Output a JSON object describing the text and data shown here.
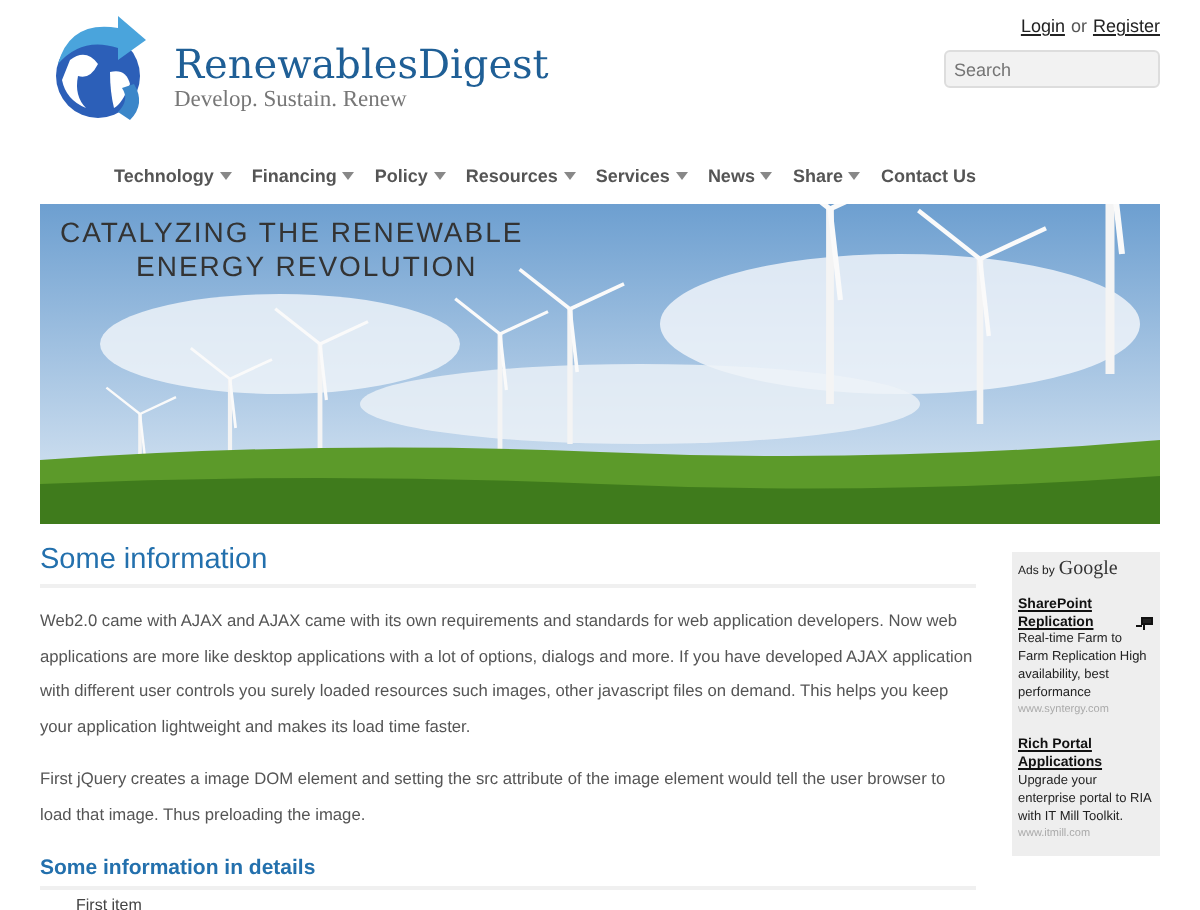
{
  "header": {
    "site_title": "RenewablesDigest",
    "tagline": "Develop. Sustain. Renew",
    "login": "Login",
    "separator": "or",
    "register": "Register",
    "search": {
      "placeholder": "Search"
    }
  },
  "nav": [
    {
      "label": "Technology",
      "dropdown": true
    },
    {
      "label": "Financing",
      "dropdown": true
    },
    {
      "label": "Policy",
      "dropdown": true
    },
    {
      "label": "Resources",
      "dropdown": true
    },
    {
      "label": "Services",
      "dropdown": true
    },
    {
      "label": "News",
      "dropdown": true
    },
    {
      "label": "Share",
      "dropdown": true
    },
    {
      "label": "Contact Us",
      "dropdown": false
    }
  ],
  "banner": {
    "headline_line1": "CATALYZING THE RENEWABLE",
    "headline_line2": "ENERGY REVOLUTION"
  },
  "content": {
    "heading": "Some information",
    "paragraphs": [
      "Web2.0 came with AJAX and AJAX came with its own requirements and standards for web application developers. Now web applications are more like desktop applications with a lot of options, dialogs and more. If you have developed AJAX application with different user controls you surely loaded resources such images, other javascript files on demand. This helps you keep your application lightweight and makes its load time faster.",
      "First jQuery creates a image DOM element and setting the src attribute of the image element would tell the user browser to load that image. Thus preloading the image."
    ],
    "subheading": "Some information in details",
    "list": [
      "First item"
    ]
  },
  "ads": {
    "label": "Ads by",
    "brand": "Google",
    "items": [
      {
        "title": "SharePoint Replication",
        "text": "Real-time Farm to Farm Replication High availability, best performance",
        "url": "www.syntergy.com"
      },
      {
        "title": "Rich Portal Applications",
        "text": "Upgrade your enterprise portal to RIA with IT Mill Toolkit.",
        "url": "www.itmill.com"
      }
    ]
  }
}
